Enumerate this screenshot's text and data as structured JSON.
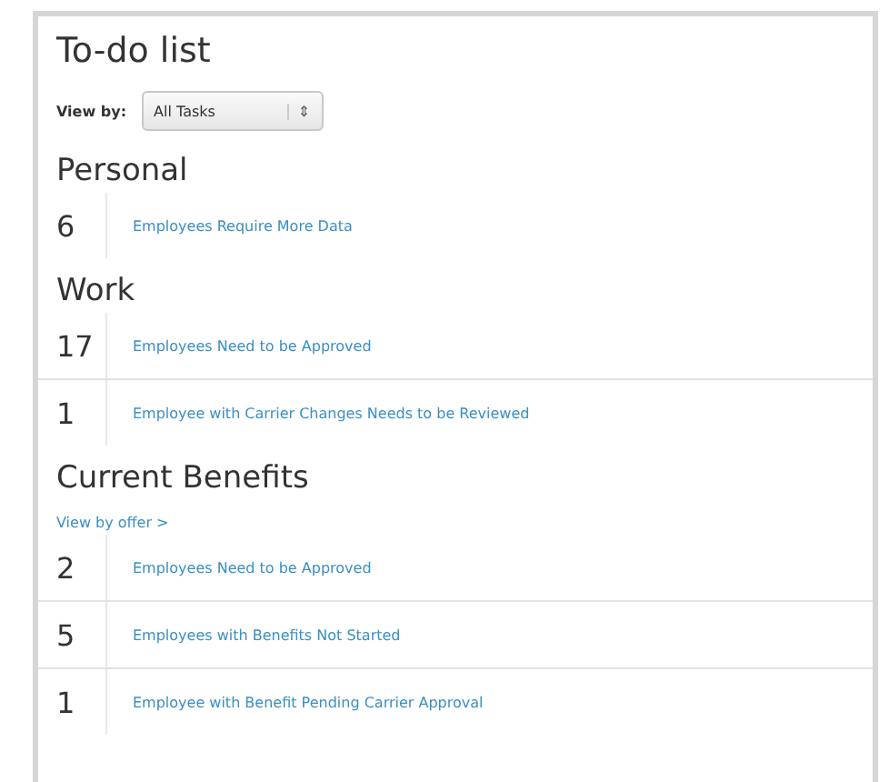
{
  "title": "To-do list",
  "view_by": {
    "label": "View by:",
    "value": "All Tasks",
    "control": "⇕"
  },
  "sections": [
    {
      "heading": "Personal",
      "tasks": [
        {
          "count": "6",
          "label": "Employees Require More Data"
        }
      ]
    },
    {
      "heading": "Work",
      "tasks": [
        {
          "count": "17",
          "label": "Employees Need to be Approved"
        },
        {
          "count": "1",
          "label": "Employee with Carrier Changes Needs to be Reviewed"
        }
      ]
    },
    {
      "heading": "Current Benefits",
      "link": "View by offer >",
      "tasks": [
        {
          "count": "2",
          "label": "Employees Need to be Approved"
        },
        {
          "count": "5",
          "label": "Employees with Benefits Not Started"
        },
        {
          "count": "1",
          "label": "Employee with Benefit Pending Carrier Approval"
        }
      ]
    }
  ]
}
